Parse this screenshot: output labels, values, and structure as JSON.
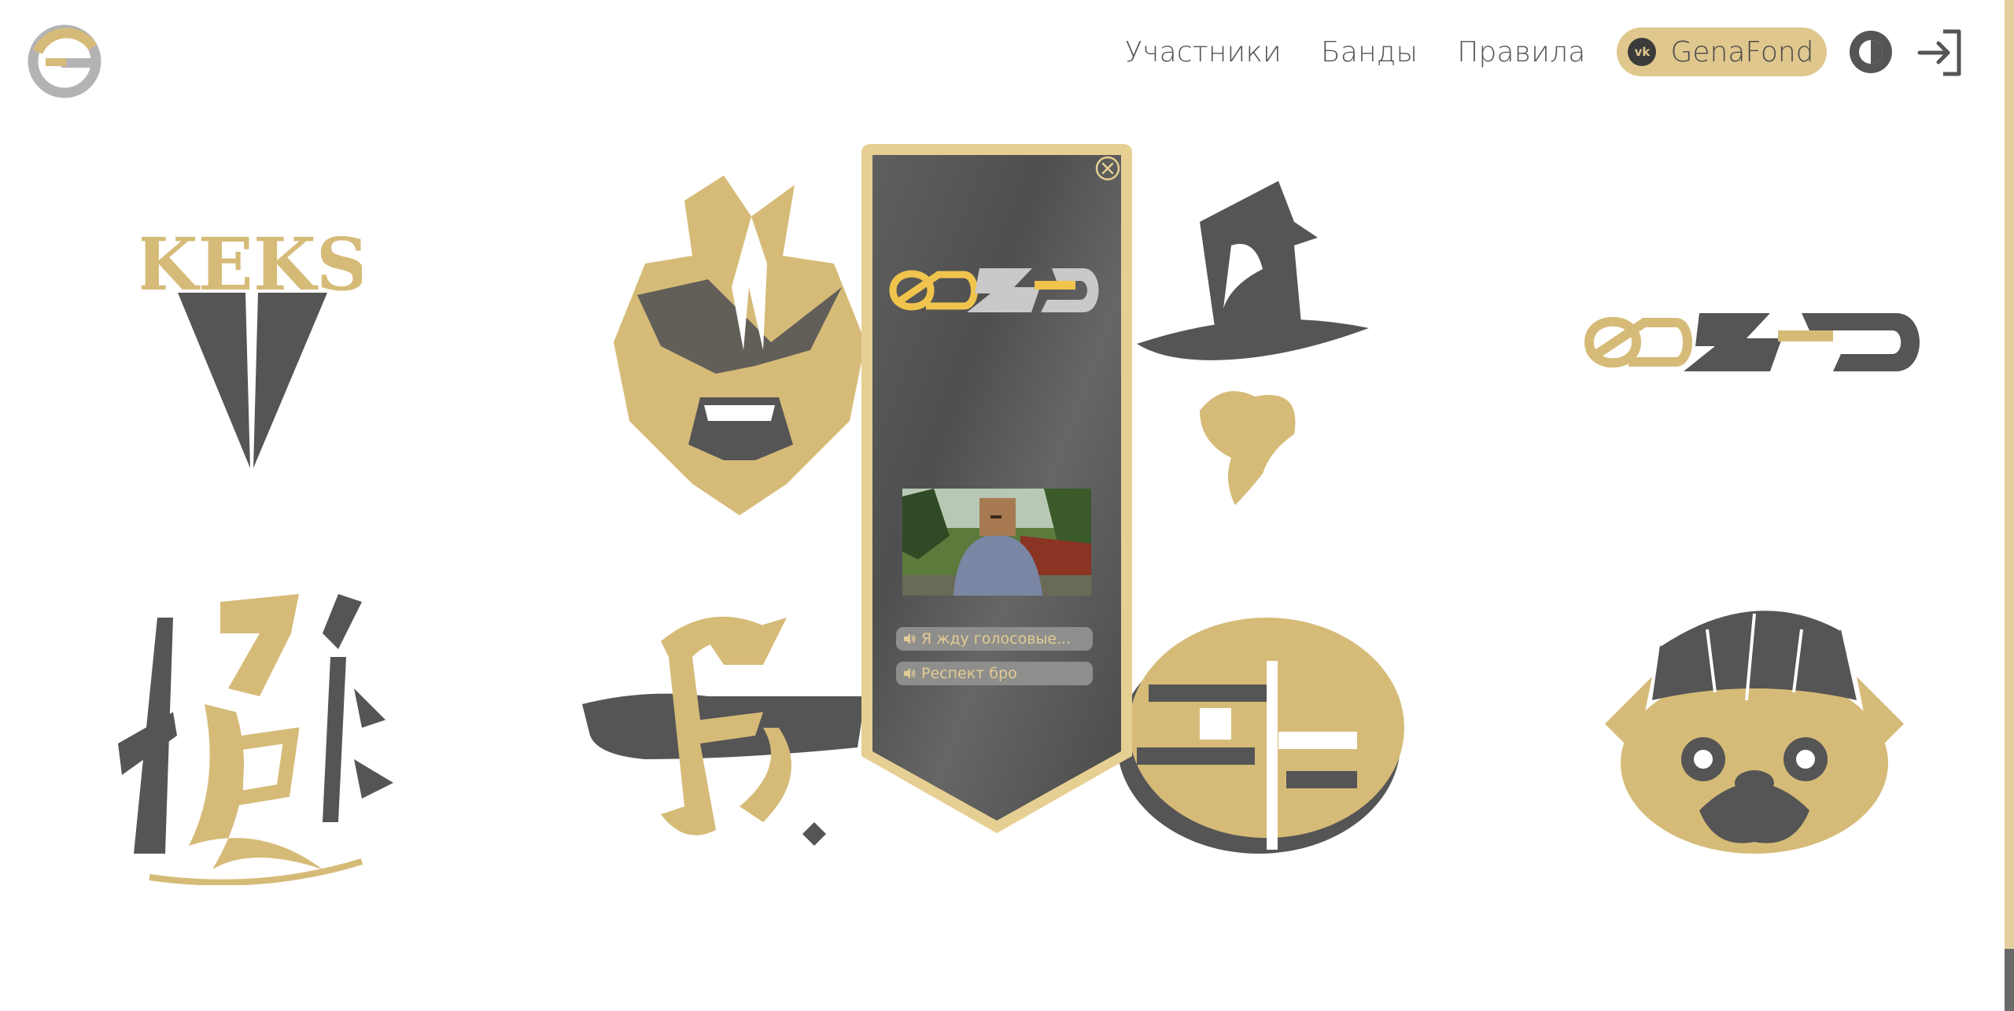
{
  "header": {
    "nav": [
      {
        "label": "Участники"
      },
      {
        "label": "Банды"
      },
      {
        "label": "Правила"
      }
    ],
    "vk_button": {
      "icon": "vk-icon",
      "label": "GenaFond"
    },
    "theme_toggle": {
      "icon": "contrast-icon"
    },
    "login": {
      "icon": "login-icon"
    }
  },
  "colors": {
    "gold": "#d6bb78",
    "dark": "#555555",
    "card_border": "#e6cf92",
    "pill": "#dfc78e"
  },
  "gangs": [
    {
      "id": "keks",
      "text": "KEKS"
    },
    {
      "id": "gorilla"
    },
    {
      "id": "wizard"
    },
    {
      "id": "ezed-logo"
    },
    {
      "id": "hieroglyph"
    },
    {
      "id": "gothic-f"
    },
    {
      "id": "eg-monogram"
    },
    {
      "id": "pug"
    }
  ],
  "popup": {
    "close_icon": "close-icon",
    "logo": "ezed-logo",
    "voices": [
      {
        "icon": "speaker-icon",
        "label": "Я жду голосовые..."
      },
      {
        "icon": "speaker-icon",
        "label": "Респект бро"
      }
    ]
  }
}
